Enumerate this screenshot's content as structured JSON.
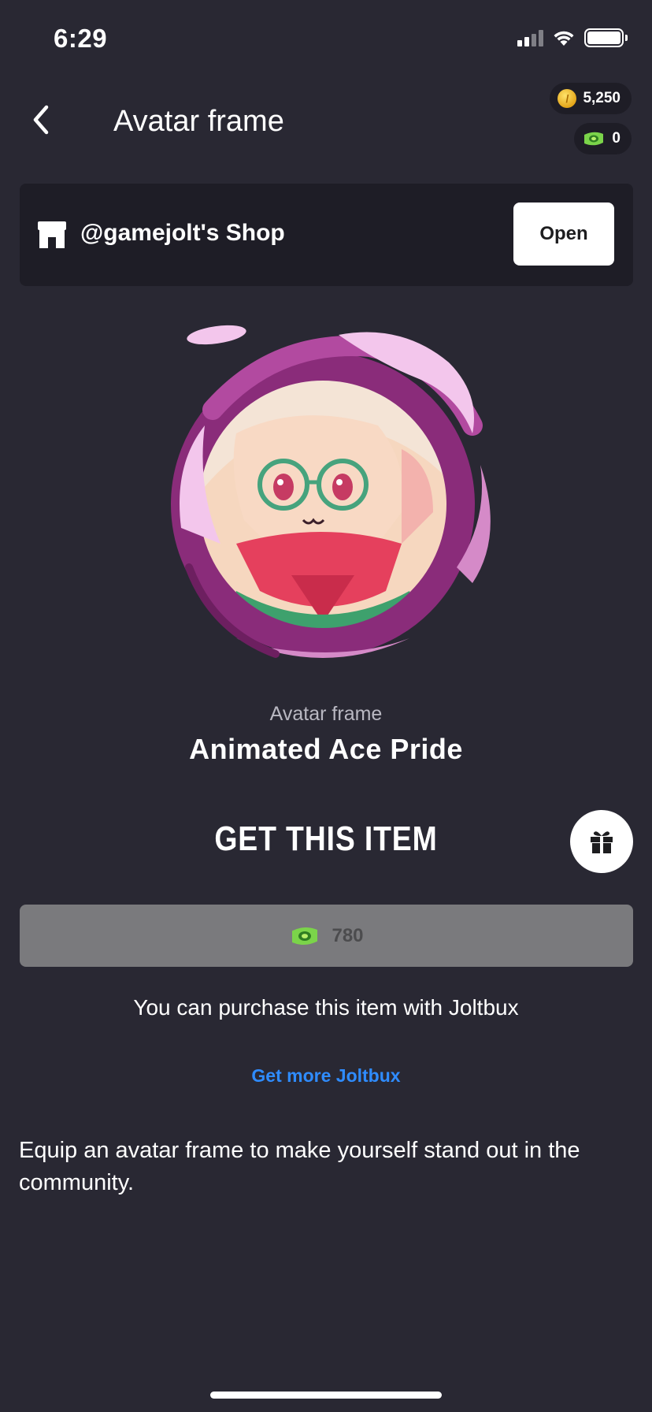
{
  "status_bar": {
    "time": "6:29"
  },
  "header": {
    "title": "Avatar frame",
    "coins": "5,250",
    "joltbux": "0"
  },
  "shop": {
    "name": "@gamejolt's Shop",
    "open_label": "Open"
  },
  "item": {
    "type_label": "Avatar frame",
    "name": "Animated Ace Pride",
    "get_heading": "GET THIS ITEM",
    "price": "780",
    "purchase_note": "You can purchase this item with Joltbux",
    "get_more_link": "Get more Joltbux",
    "description": "Equip an avatar frame to make yourself stand out in the community."
  },
  "colors": {
    "background": "#292833",
    "panel": "#1e1d26",
    "link": "#2f8cff",
    "buy_button_disabled": "#7a7a7d",
    "frame_purple": "#8a2c7a",
    "frame_highlight": "#f3c6ec"
  },
  "icons": [
    "back-arrow-icon",
    "coin-icon",
    "joltbux-icon",
    "shop-icon",
    "gift-icon",
    "signal-icon",
    "wifi-icon",
    "battery-icon"
  ]
}
